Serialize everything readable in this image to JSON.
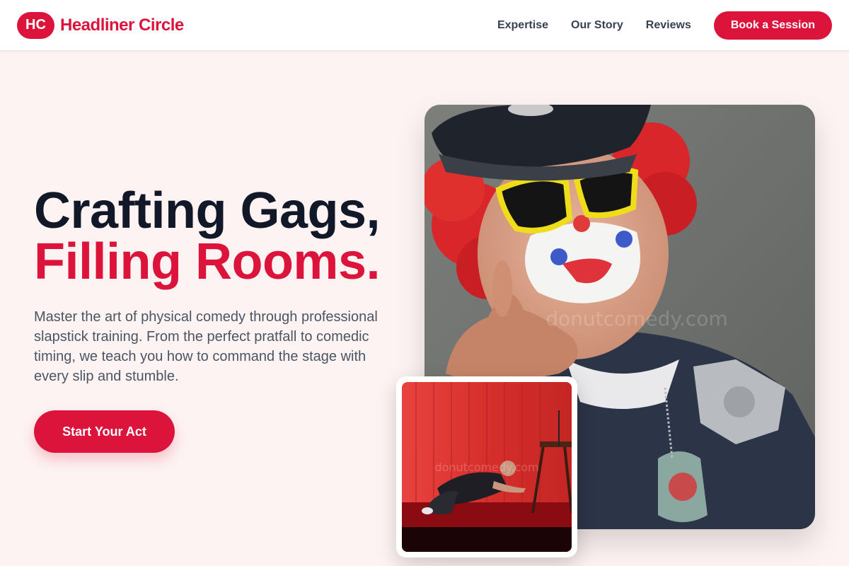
{
  "header": {
    "badge": "HC",
    "brand": "Headliner Circle",
    "nav": [
      "Expertise",
      "Our Story",
      "Reviews"
    ],
    "cta": "Book a Session"
  },
  "hero": {
    "title_line1": "Crafting Gags,",
    "title_line2": "Filling Rooms.",
    "description": "Master the art of physical comedy through professional slapstick training. From the perfect pratfall to comedic timing, we teach you how to command the stage with every slip and stumble.",
    "cta": "Start Your Act"
  },
  "images": {
    "main": {
      "watermark": "donutcomedy.com"
    },
    "inset": {
      "watermark": "donutcomedy.com"
    }
  },
  "colors": {
    "accent": "#dc143c",
    "heading": "#111827",
    "background": "#fdf3f2"
  }
}
